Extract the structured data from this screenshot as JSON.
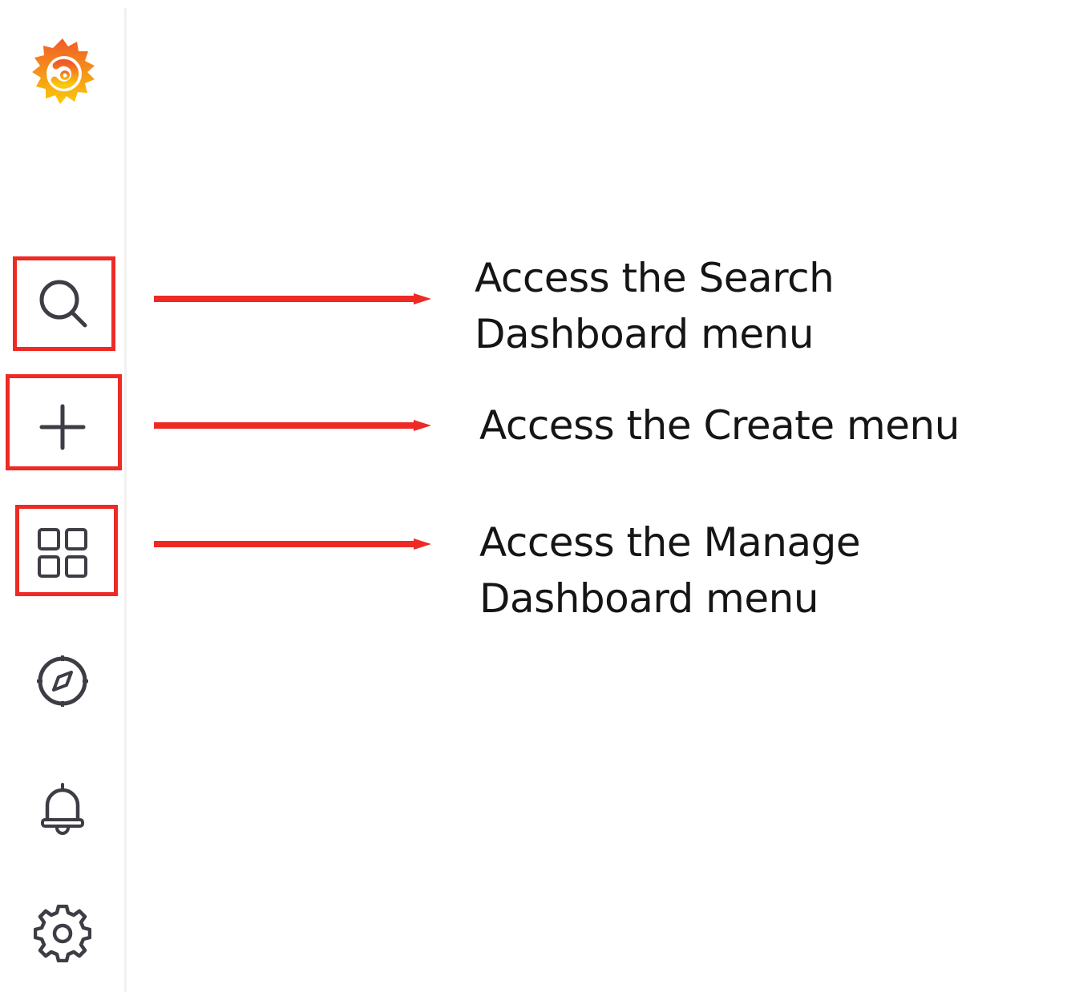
{
  "sidebar": {
    "logo": {
      "icon": "grafana-logo-icon"
    },
    "items": [
      {
        "icon": "search-icon",
        "label": "Search"
      },
      {
        "icon": "plus-icon",
        "label": "Create"
      },
      {
        "icon": "dashboards-grid-icon",
        "label": "Dashboards"
      },
      {
        "icon": "compass-icon",
        "label": "Explore"
      },
      {
        "icon": "bell-icon",
        "label": "Alerting"
      },
      {
        "icon": "gear-icon",
        "label": "Configuration"
      }
    ]
  },
  "annotations": [
    {
      "text": "Access the Search Dashboard menu"
    },
    {
      "text": "Access the Create menu"
    },
    {
      "text": "Access the Manage Dashboard menu"
    }
  ],
  "colors": {
    "highlight": "#ee2a24",
    "arrow": "#ee2a24",
    "icon": "#3d3d45",
    "logo_orange": "#f05a28",
    "logo_yellow": "#fbca0a"
  }
}
